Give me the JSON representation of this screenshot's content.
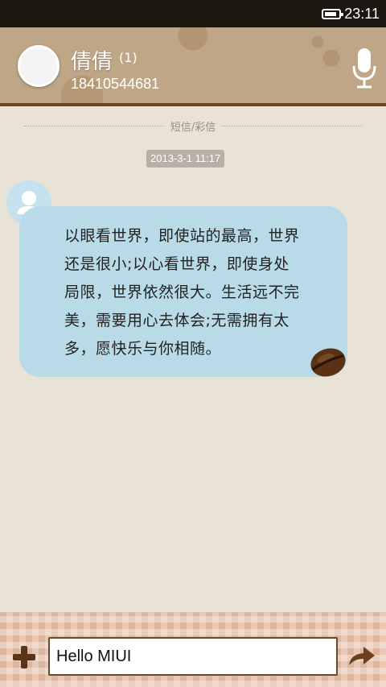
{
  "status_bar": {
    "time": "23:11",
    "battery_icon": "battery-icon"
  },
  "header": {
    "contact_name": "倩倩",
    "unread_count": "(1)",
    "phone_number": "18410544681",
    "avatar_icon": "person-avatar-icon",
    "mic_icon": "microphone-icon"
  },
  "conversation": {
    "type_label": "短信/彩信",
    "timestamp": "2013-3-1 11:17",
    "messages": [
      {
        "direction": "incoming",
        "lines": [
          "以眼看世界，即使站的最高，世界",
          "还是很小;以心看世界，即使身处",
          "局限，世界依然很大。生活远不完",
          "美，需要用心去体会;无需拥有太",
          "多，愿快乐与你相随。"
        ]
      }
    ]
  },
  "composer": {
    "input_value": "Hello MIUI",
    "add_icon": "plus-icon",
    "send_icon": "send-arrow-icon"
  },
  "colors": {
    "header_bg": "#bfa687",
    "header_border": "#6e4620",
    "bubble_bg": "#b9dbe8",
    "accent_brown": "#6b4826"
  }
}
